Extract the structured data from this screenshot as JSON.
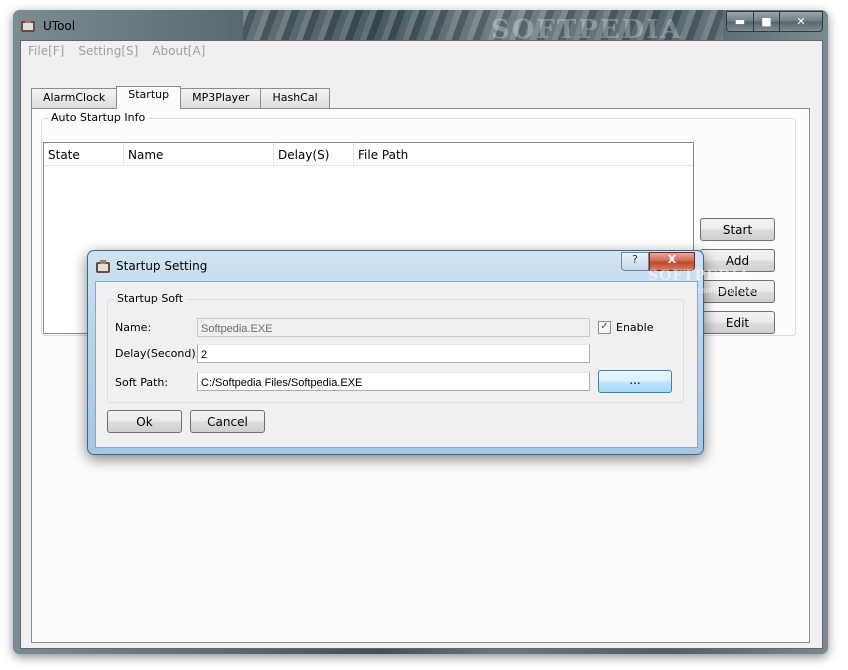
{
  "window": {
    "title": "UTool",
    "watermark": "SOFTPEDIA"
  },
  "menu": [
    "File[F]",
    "Setting[S]",
    "About[A]"
  ],
  "tabs": [
    "AlarmClock",
    "Startup",
    "MP3Player",
    "HashCal"
  ],
  "active_tab": "Startup",
  "startup": {
    "group_label": "Auto Startup Info",
    "columns": [
      "State",
      "Name",
      "Delay(S)",
      "File Path"
    ],
    "rows": [],
    "buttons": {
      "start": "Start",
      "add": "Add",
      "delete": "Delete",
      "edit": "Edit"
    }
  },
  "dialog": {
    "title": "Startup Setting",
    "help_glyph": "?",
    "close_glyph": "X",
    "watermark": "SOFTPEDIA",
    "watermark_url": "www.softpedia.com",
    "group_label": "Startup Soft",
    "name_label": "Name:",
    "name_value": "Softpedia.EXE",
    "enable_label": "Enable",
    "enable_checked": true,
    "delay_label": "Delay(Second):",
    "delay_value": "2",
    "path_label": "Soft Path:",
    "path_value": "C:/Softpedia Files/Softpedia.EXE",
    "browse_label": "...",
    "ok_label": "Ok",
    "cancel_label": "Cancel"
  }
}
